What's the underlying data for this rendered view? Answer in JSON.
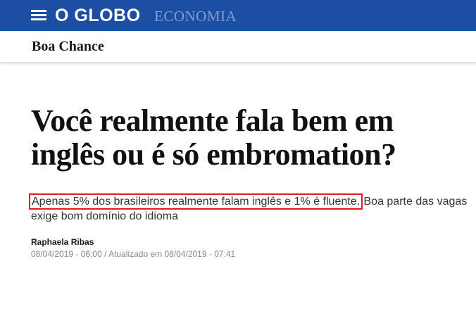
{
  "header": {
    "logo": "O GLOBO",
    "section": "ECONOMIA"
  },
  "subheader": {
    "title": "Boa Chance"
  },
  "article": {
    "headline": "Você realmente fala bem em inglês ou é só embromation?",
    "subtitle_highlight": "Apenas 5% dos brasileiros realmente falam inglês e 1% é fluente.",
    "subtitle_rest": " Boa parte das vagas exige bom domínio do idioma",
    "author": "Raphaela Ribas",
    "dates": "08/04/2019 - 06:00 / Atualizado em 08/04/2019 - 07:41"
  },
  "colors": {
    "header_bg": "#1c4ea3",
    "section_text": "#7f9fd2",
    "highlight_border": "#e21b23"
  },
  "icons": [
    "hamburger-menu-icon"
  ]
}
